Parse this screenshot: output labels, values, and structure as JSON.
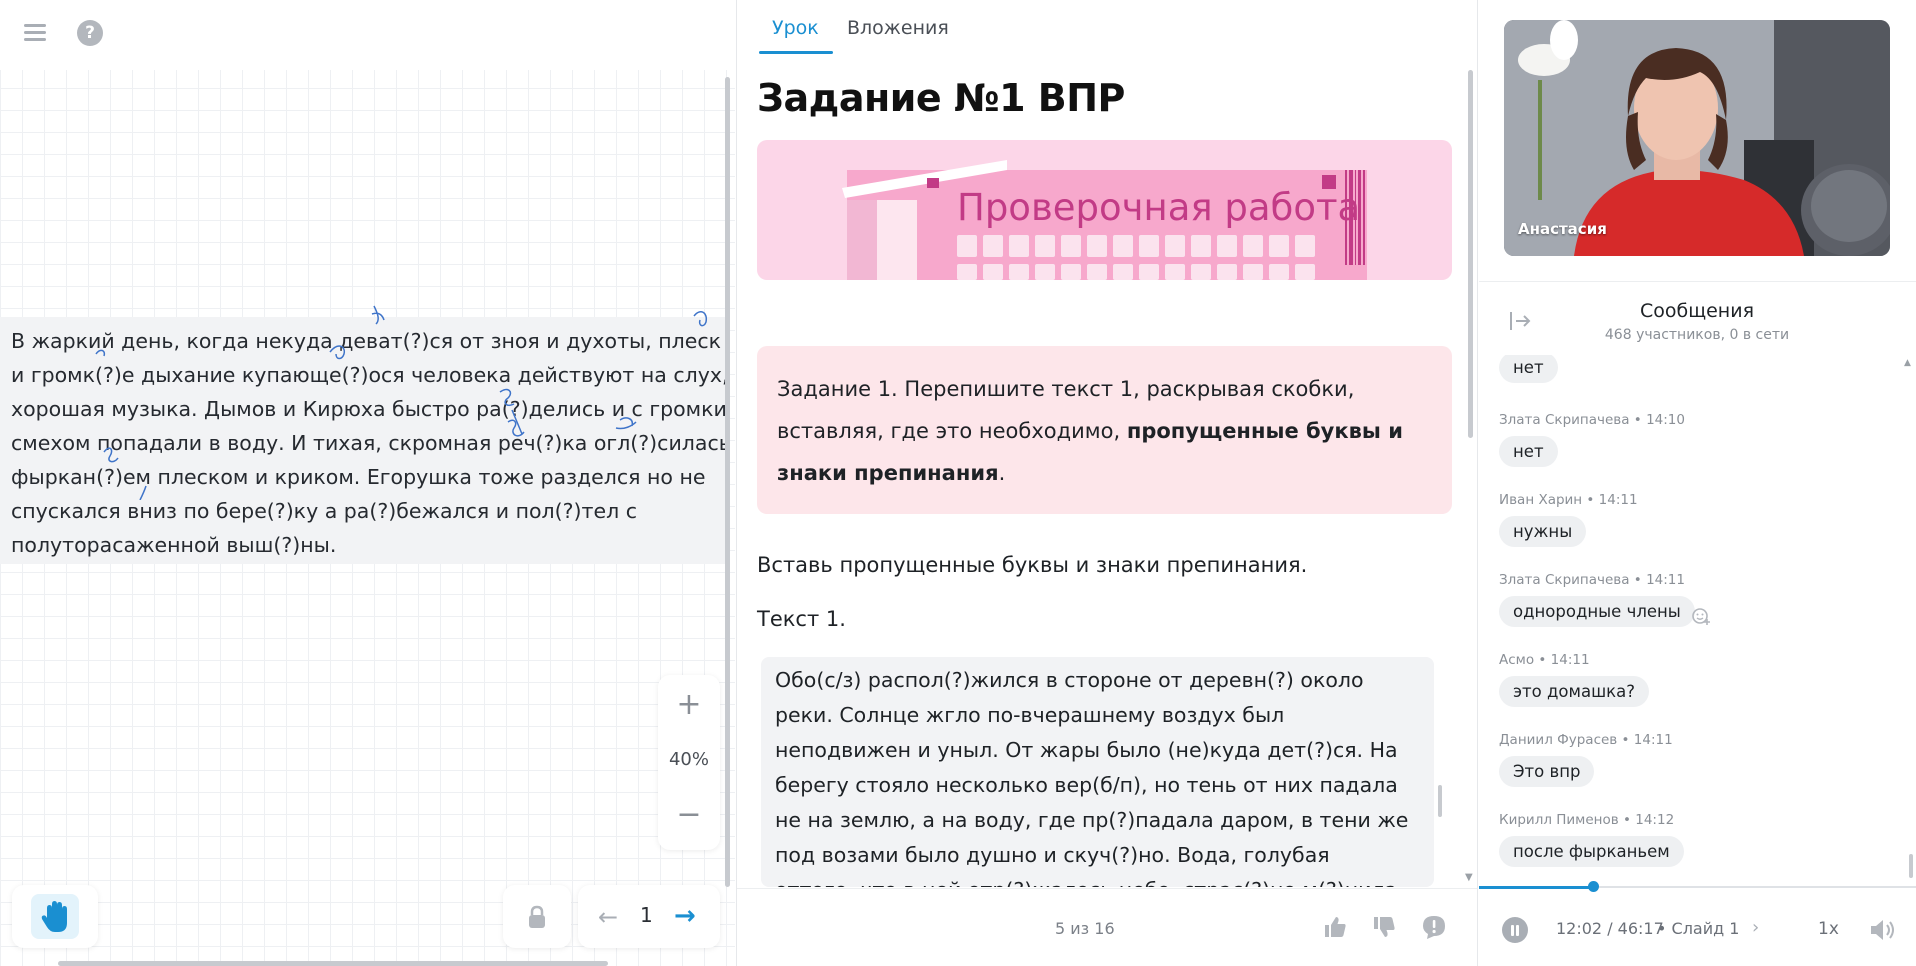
{
  "board": {
    "text_lines": [
      "В жаркий день, когда некуда деват(?)ся от зноя и духоты, плеск в(?)ды",
      "и громк(?)е дыхание купающе(?)ося человека действуют на слух, как",
      "хорошая музыка. Дымов и Кирюха быстро ра(?)делись и с громким",
      "смехом попадали в воду. И тихая, скромная реч(?)ка огл(?)силась",
      "фыркан(?)ем плеском и криком. Егорушка тоже разделся но не",
      "спускался вниз по бере(?)ку а ра(?)бежался и пол(?)тел с",
      "полуторасаженной выш(?)ны."
    ],
    "zoom": {
      "plus": "+",
      "level": "40%",
      "minus": "−"
    },
    "page": {
      "prev": "←",
      "number": "1",
      "next": "→"
    }
  },
  "lesson": {
    "tabs": [
      "Урок",
      "Вложения"
    ],
    "title": "Задание №1 ВПР",
    "banner_text": "Проверочная работа",
    "task": {
      "prefix": "Задание 1. Перепишите текст 1, раскрывая скобки, вставляя, где это необходимо, ",
      "bold": "пропущенные буквы и знаки препинания",
      "suffix": "."
    },
    "instruction": "Вставь пропущенные буквы и знаки препинания.",
    "text_label": "Текст 1.",
    "text1_lines": [
      "Обо(с/з) распол(?)жился в стороне от деревн(?) около",
      "реки. Солнце жгло по-вчерашнему воздух был",
      "неподвижен и уныл. От жары было (не)куда дет(?)ся. На",
      "берегу стояло несколько вер(б/п), но тень от них падала",
      "не на землю, а на воду, где пр(?)падала даром, в тени же",
      "под возами было душно и скуч(?)но. Вода, голубая",
      "оттого, что в ней отр(?)жалось небо, страс(?)но м(?)нила"
    ],
    "footer": {
      "slide_count": "5 из 16"
    }
  },
  "side": {
    "presenter": "Анастасия",
    "chat": {
      "title": "Сообщения",
      "subtitle": "468 участников, 0 в сети",
      "messages": [
        {
          "meta": "",
          "text": "нет"
        },
        {
          "meta": "Злата Скрипачева • 14:10",
          "text": "нет"
        },
        {
          "meta": "Иван Харин • 14:11",
          "text": "нужны"
        },
        {
          "meta": "Злата Скрипачева • 14:11",
          "text": "однородные члены"
        },
        {
          "meta": "Асмо • 14:11",
          "text": "это домашка?"
        },
        {
          "meta": "Даниил Фурасев • 14:11",
          "text": "Это впр"
        },
        {
          "meta": "Кирилл Пименов • 14:12",
          "text": "после фырканьем"
        }
      ]
    },
    "player": {
      "time": "12:02 / 46:17",
      "slide": "• Слайд 1",
      "speed": "1x",
      "progress": 0.26
    }
  },
  "colors": {
    "accent": "#1a8fd1",
    "task_bg": "#fde6ea",
    "banner_bg": "#fcd6e8",
    "banner_text": "#c23b86"
  },
  "icons": [
    "menu-icon",
    "help-icon",
    "hand-icon",
    "lock-icon",
    "arrow-left-icon",
    "arrow-right-icon",
    "like-icon",
    "dislike-icon",
    "report-icon",
    "collapse-panel-icon",
    "add-reaction-icon",
    "pause-icon",
    "chevron-right-icon",
    "volume-icon"
  ]
}
